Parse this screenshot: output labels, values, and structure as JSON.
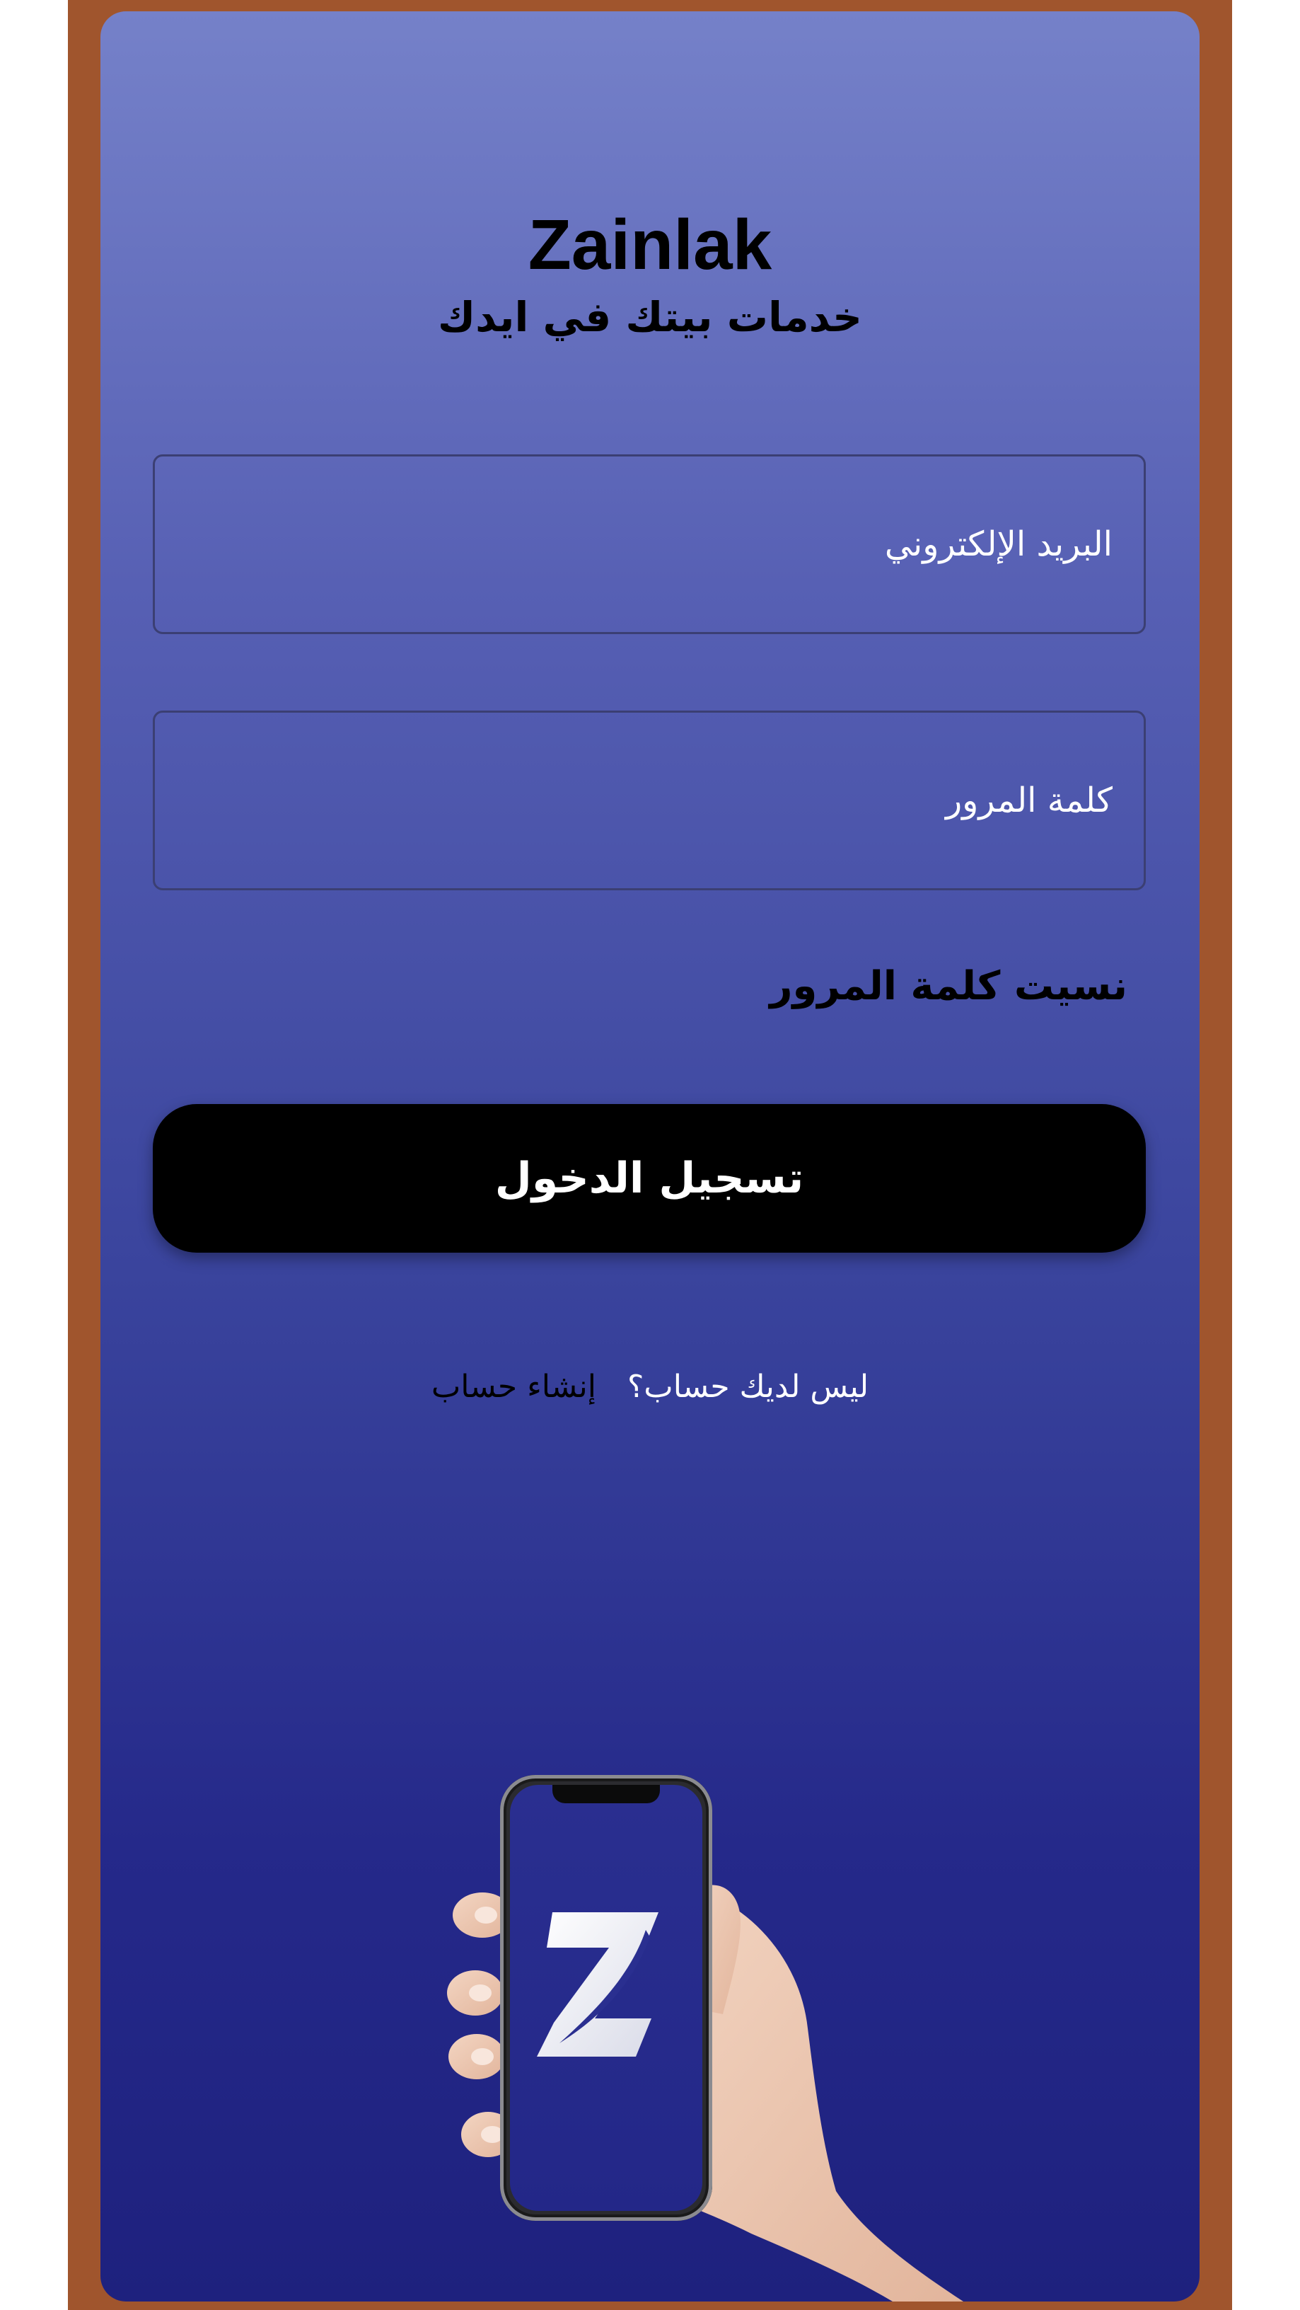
{
  "app": {
    "title": "Zainlak",
    "tagline": "خدمات بيتك في ايدك"
  },
  "form": {
    "email_placeholder": "البريد الإلكتروني",
    "password_placeholder": "كلمة المرور",
    "forgot_password": "نسيت كلمة المرور",
    "login_label": "تسجيل الدخول"
  },
  "signup": {
    "question": "ليس لديك حساب؟",
    "link": "إنشاء حساب"
  },
  "illustration": {
    "icon": "hand-holding-phone-icon",
    "logo_icon": "zainlak-z-logo-icon"
  },
  "colors": {
    "frame": "#a0552d",
    "gradient_top": "#7581c9",
    "gradient_bottom": "#1e217e",
    "button": "#000000",
    "field_border": "#3b3f73"
  }
}
